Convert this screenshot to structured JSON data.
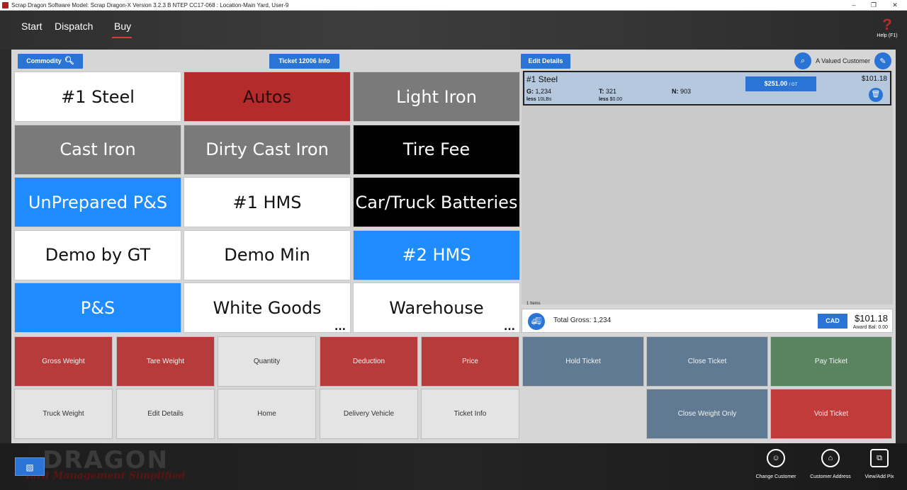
{
  "window": {
    "title": "Scrap Dragon Software Model: Scrap Dragon-X Version 3.2.3 B NTEP CC17-068 : Location-Main Yard, User-9",
    "minimize": "–",
    "restore": "❐",
    "close": "✕"
  },
  "nav": {
    "items": [
      "Start",
      "Dispatch",
      "Buy"
    ],
    "active": "Buy",
    "help_label": "Help (F1)",
    "help_glyph": "?"
  },
  "toolbar": {
    "commodity_label": "Commodity",
    "ticket_info_label": "Ticket 12006 Info",
    "edit_details_label": "Edit Details",
    "customer_name": "A Valued Customer"
  },
  "commodities": [
    {
      "label": "#1 Steel",
      "color": "white"
    },
    {
      "label": "Autos",
      "color": "red"
    },
    {
      "label": "Light Iron",
      "color": "gray"
    },
    {
      "label": "Cast Iron",
      "color": "gray"
    },
    {
      "label": "Dirty Cast Iron",
      "color": "gray"
    },
    {
      "label": "Tire Fee",
      "color": "black"
    },
    {
      "label": "UnPrepared P&S",
      "color": "blue"
    },
    {
      "label": "#1 HMS",
      "color": "white"
    },
    {
      "label": "Car/Truck Batteries",
      "color": "black"
    },
    {
      "label": "Demo by GT",
      "color": "white"
    },
    {
      "label": "Demo Min",
      "color": "white"
    },
    {
      "label": "#2 HMS",
      "color": "blue"
    },
    {
      "label": "P&S",
      "color": "blue"
    },
    {
      "label": "White Goods",
      "color": "white",
      "more": "..."
    },
    {
      "label": "Warehouse",
      "color": "white",
      "more": "..."
    }
  ],
  "ticket_line": {
    "name": "#1 Steel",
    "gross_label": "G:",
    "gross": "1,234",
    "tare_label": "T:",
    "tare": "321",
    "net_label": "N:",
    "net": "903",
    "less_weight_label": "less",
    "less_weight": "10LBs",
    "less_amount_label": "less",
    "less_amount": "$0.00",
    "price": "$251.00",
    "price_unit": "/ GT",
    "amount": "$101.18"
  },
  "summary": {
    "items_count": "1  Items",
    "total_gross": "Total Gross: 1,234",
    "currency": "CAD",
    "total_amount": "$101.18",
    "award_bal": "Award Bal:  0.00"
  },
  "actions": {
    "row1": [
      "Gross Weight",
      "Tare Weight",
      "Quantity",
      "Deduction",
      "Price"
    ],
    "row2": [
      "Truck Weight",
      "Edit Details",
      "Home",
      "Delivery Vehicle",
      "Ticket Info"
    ],
    "hold": "Hold Ticket",
    "close": "Close Ticket",
    "pay": "Pay Ticket",
    "close_weight": "Close Weight Only",
    "void": "Void Ticket"
  },
  "footer": {
    "brand": "DRAGON",
    "tagline": "Yard Management Simplified",
    "buttons": [
      "Change Customer",
      "Customer Address",
      "View/Add Pix"
    ]
  },
  "colors": {
    "accent_blue": "#2a74d6",
    "tile_red": "#b52a2a",
    "tile_blue": "#1e8cff",
    "action_red": "#b83b3b",
    "action_slate": "#5f7a92",
    "action_green": "#5a8460"
  }
}
